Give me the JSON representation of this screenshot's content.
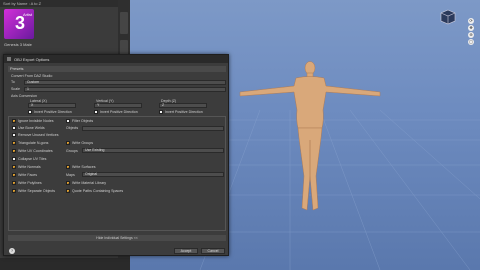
{
  "left_panel": {
    "sort_label": "Sort by Name : A to Z",
    "thumb_title": "3",
    "thumb_artist": "Artist",
    "thumb_caption": "Genesis 3 Male"
  },
  "dialog": {
    "title": "OBJ Export Options",
    "presets_label": "Presets",
    "convert_label": "Convert From DAZ Studio",
    "to_label": "To",
    "to_value": "Custom",
    "scale_label": "Scale",
    "scale_value": "1",
    "axis_label": "Axis Conversion",
    "lateral_label": "Lateral (X)",
    "lateral_value": "X",
    "vertical_label": "Vertical (Y)",
    "vertical_value": "Y",
    "depth_label": "Depth (Z)",
    "depth_value": "Z",
    "invert_label": "Invert Positive Direction",
    "ignore_invisible": "Ignore Invisible Nodes",
    "filter_objects": "Filter Objects",
    "use_bone_weld": "Use Bone Welds",
    "objects_label": "Objects",
    "remove_unused": "Remove Unused Vertices",
    "triangulate": "Triangulate N-gons",
    "write_groups": "Write Groups",
    "write_uv": "Write UV Coordinates",
    "groups_label": "Groups",
    "groups_value": "Use Existing",
    "collapse_uv": "Collapse UV Tiles",
    "write_normals": "Write Normals",
    "write_surfaces": "Write Surfaces",
    "write_faces": "Write Faces",
    "maps_label": "Maps",
    "maps_value": "Original",
    "write_polylines": "Write Polylines",
    "write_material": "Write Material Library",
    "write_separate": "Write Separate Objects",
    "quote_paths": "Quote Paths Containing Spaces",
    "hide_settings": "Hide Individual Settings <<",
    "accept": "Accept",
    "cancel": "Cancel",
    "help": "?"
  },
  "viewport_icons": [
    "rotate-icon",
    "pan-icon",
    "zoom-icon",
    "frame-icon"
  ]
}
